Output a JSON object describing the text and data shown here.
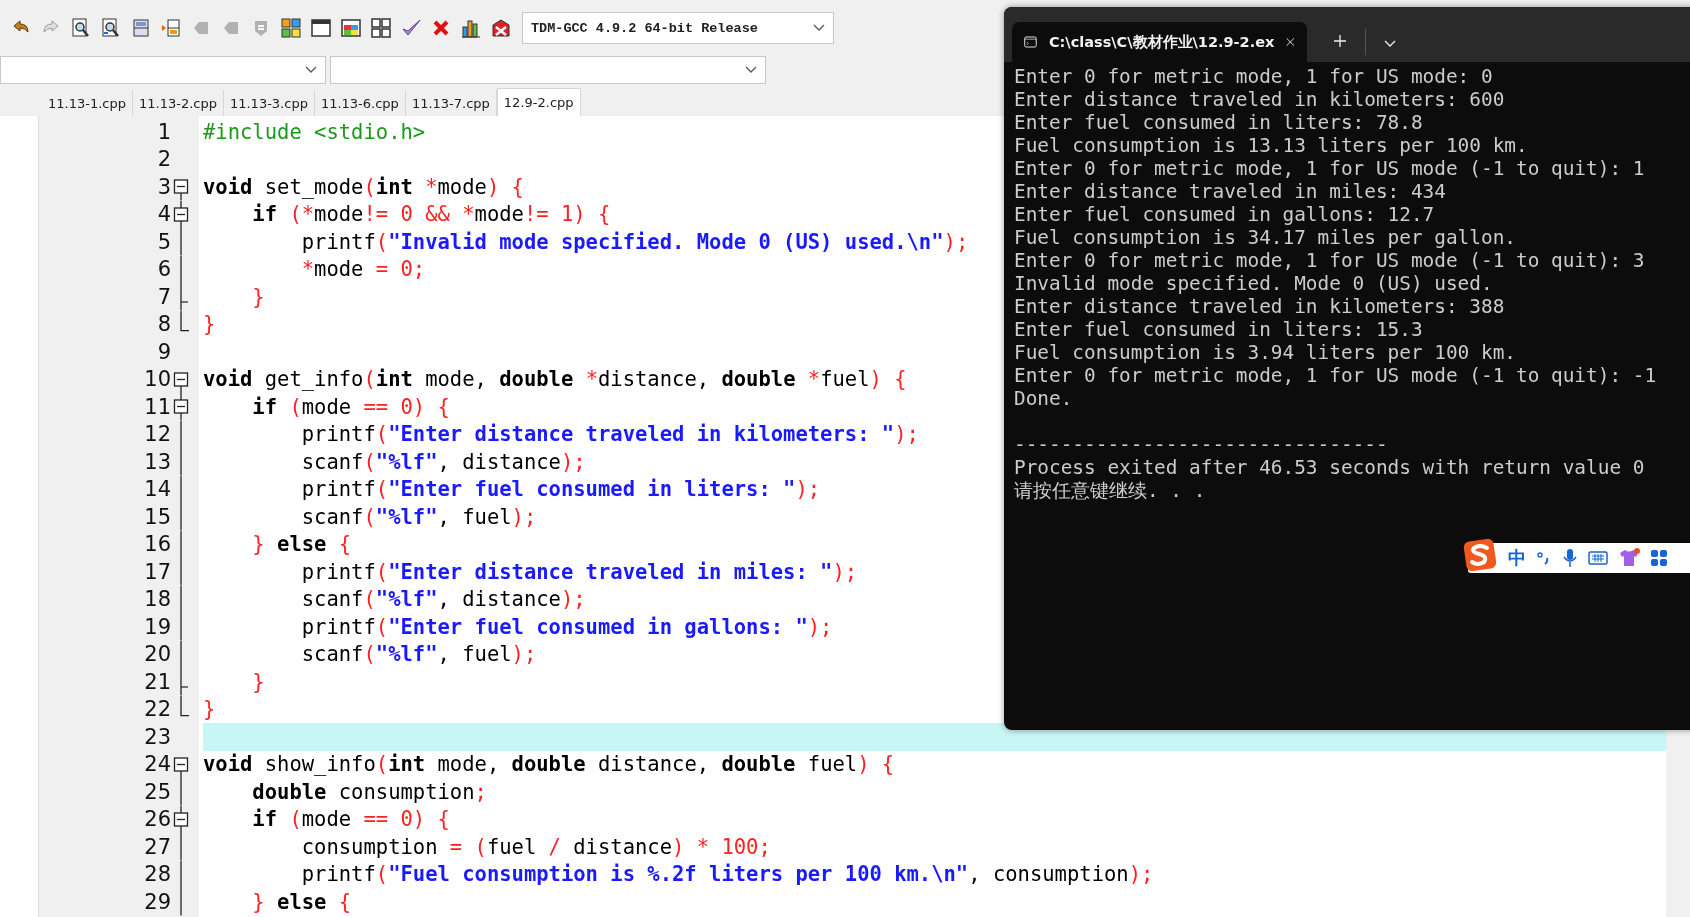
{
  "toolbar": [
    {
      "kind": "undo",
      "disabled": false
    },
    {
      "kind": "redo",
      "disabled": true
    },
    {
      "kind": "find",
      "disabled": false
    },
    {
      "kind": "replace",
      "disabled": false
    },
    {
      "kind": "indent",
      "disabled": false
    },
    {
      "kind": "unindent",
      "disabled": false
    },
    {
      "kind": "bookmark",
      "disabled": true
    },
    {
      "kind": "bookmark",
      "disabled": true
    },
    {
      "kind": "goto",
      "disabled": true
    },
    {
      "kind": "compile",
      "disabled": false
    },
    {
      "kind": "run",
      "disabled": false
    },
    {
      "kind": "compile-run",
      "disabled": false
    },
    {
      "kind": "rebuild",
      "disabled": false
    },
    {
      "kind": "check",
      "disabled": false
    },
    {
      "kind": "close",
      "disabled": false
    },
    {
      "kind": "chart",
      "disabled": false
    },
    {
      "kind": "debug",
      "disabled": false
    }
  ],
  "compiler": {
    "value": "TDM-GCC 4.9.2 64-bit Release"
  },
  "tabs": [
    {
      "label": "11.13-1.cpp",
      "selected": false
    },
    {
      "label": "11.13-2.cpp",
      "selected": false
    },
    {
      "label": "11.13-3.cpp",
      "selected": false
    },
    {
      "label": "11.13-6.cpp",
      "selected": false
    },
    {
      "label": "11.13-7.cpp",
      "selected": false
    },
    {
      "label": "12.9-2.cpp",
      "selected": true
    }
  ],
  "editor": {
    "lines": [
      {
        "number": "1",
        "current": false,
        "tokens": [
          {
            "kind": "pp",
            "text": "#include <stdio.h>"
          }
        ]
      },
      {
        "number": "2",
        "current": false
      },
      {
        "number": "3",
        "kind": "open",
        "current": false,
        "tokens": [
          {
            "kind": "kw",
            "text": "void"
          },
          {
            "kind": "id",
            "text": " set_mode"
          },
          {
            "kind": "op",
            "text": "("
          },
          {
            "kind": "kw",
            "text": "int"
          },
          {
            "kind": "op",
            "text": " *"
          },
          {
            "kind": "id",
            "text": "mode"
          },
          {
            "kind": "op",
            "text": ") {"
          }
        ]
      },
      {
        "number": "4",
        "kind": "open-inner",
        "current": false,
        "tokens": [
          {
            "kind": "kw",
            "text": "    if"
          },
          {
            "kind": "op",
            "text": " (*"
          },
          {
            "kind": "id",
            "text": "mode"
          },
          {
            "kind": "op",
            "text": "!= "
          },
          {
            "kind": "num",
            "text": "0"
          },
          {
            "kind": "op",
            "text": " && *"
          },
          {
            "kind": "id",
            "text": "mode"
          },
          {
            "kind": "op",
            "text": "!= "
          },
          {
            "kind": "num",
            "text": "1"
          },
          {
            "kind": "op",
            "text": ") {"
          }
        ]
      },
      {
        "number": "5",
        "kind": "body",
        "current": false,
        "tokens": [
          {
            "kind": "id",
            "text": "        printf"
          },
          {
            "kind": "op",
            "text": "("
          },
          {
            "kind": "str",
            "text": "\"Invalid mode specified. Mode 0 (US) used.\\n\""
          },
          {
            "kind": "op",
            "text": ");"
          }
        ]
      },
      {
        "number": "6",
        "kind": "body",
        "current": false,
        "tokens": [
          {
            "kind": "op",
            "text": "        *"
          },
          {
            "kind": "id",
            "text": "mode"
          },
          {
            "kind": "op",
            "text": " = "
          },
          {
            "kind": "num",
            "text": "0"
          },
          {
            "kind": "op",
            "text": ";"
          }
        ]
      },
      {
        "number": "7",
        "kind": "end-inner",
        "current": false,
        "tokens": [
          {
            "kind": "op",
            "text": "    }"
          }
        ]
      },
      {
        "number": "8",
        "kind": "end",
        "current": false,
        "tokens": [
          {
            "kind": "op",
            "text": "}"
          }
        ]
      },
      {
        "number": "9",
        "current": false
      },
      {
        "number": "10",
        "kind": "open",
        "current": false,
        "tokens": [
          {
            "kind": "kw",
            "text": "void"
          },
          {
            "kind": "id",
            "text": " get_info"
          },
          {
            "kind": "op",
            "text": "("
          },
          {
            "kind": "kw",
            "text": "int"
          },
          {
            "kind": "id",
            "text": " mode, "
          },
          {
            "kind": "kw",
            "text": "double"
          },
          {
            "kind": "op",
            "text": " *"
          },
          {
            "kind": "id",
            "text": "distance, "
          },
          {
            "kind": "kw",
            "text": "double"
          },
          {
            "kind": "op",
            "text": " *"
          },
          {
            "kind": "id",
            "text": "fuel"
          },
          {
            "kind": "op",
            "text": ") {"
          }
        ]
      },
      {
        "number": "11",
        "kind": "open-inner",
        "current": false,
        "tokens": [
          {
            "kind": "kw",
            "text": "    if"
          },
          {
            "kind": "op",
            "text": " ("
          },
          {
            "kind": "id",
            "text": "mode"
          },
          {
            "kind": "op",
            "text": " == "
          },
          {
            "kind": "num",
            "text": "0"
          },
          {
            "kind": "op",
            "text": ") {"
          }
        ]
      },
      {
        "number": "12",
        "kind": "body",
        "current": false,
        "tokens": [
          {
            "kind": "id",
            "text": "        printf"
          },
          {
            "kind": "op",
            "text": "("
          },
          {
            "kind": "str",
            "text": "\"Enter distance traveled in kilometers: \""
          },
          {
            "kind": "op",
            "text": ");"
          }
        ]
      },
      {
        "number": "13",
        "kind": "body",
        "current": false,
        "tokens": [
          {
            "kind": "id",
            "text": "        scanf"
          },
          {
            "kind": "op",
            "text": "("
          },
          {
            "kind": "str",
            "text": "\"%lf\""
          },
          {
            "kind": "id",
            "text": ", distance"
          },
          {
            "kind": "op",
            "text": ");"
          }
        ]
      },
      {
        "number": "14",
        "kind": "body",
        "current": false,
        "tokens": [
          {
            "kind": "id",
            "text": "        printf"
          },
          {
            "kind": "op",
            "text": "("
          },
          {
            "kind": "str",
            "text": "\"Enter fuel consumed in liters: \""
          },
          {
            "kind": "op",
            "text": ");"
          }
        ]
      },
      {
        "number": "15",
        "kind": "body",
        "current": false,
        "tokens": [
          {
            "kind": "id",
            "text": "        scanf"
          },
          {
            "kind": "op",
            "text": "("
          },
          {
            "kind": "str",
            "text": "\"%lf\""
          },
          {
            "kind": "id",
            "text": ", fuel"
          },
          {
            "kind": "op",
            "text": ");"
          }
        ]
      },
      {
        "number": "16",
        "kind": "body",
        "current": false,
        "tokens": [
          {
            "kind": "op",
            "text": "    }"
          },
          {
            "kind": "kw",
            "text": " else"
          },
          {
            "kind": "op",
            "text": " {"
          }
        ]
      },
      {
        "number": "17",
        "kind": "body",
        "current": false,
        "tokens": [
          {
            "kind": "id",
            "text": "        printf"
          },
          {
            "kind": "op",
            "text": "("
          },
          {
            "kind": "str",
            "text": "\"Enter distance traveled in miles: \""
          },
          {
            "kind": "op",
            "text": ");"
          }
        ]
      },
      {
        "number": "18",
        "kind": "body",
        "current": false,
        "tokens": [
          {
            "kind": "id",
            "text": "        scanf"
          },
          {
            "kind": "op",
            "text": "("
          },
          {
            "kind": "str",
            "text": "\"%lf\""
          },
          {
            "kind": "id",
            "text": ", distance"
          },
          {
            "kind": "op",
            "text": ");"
          }
        ]
      },
      {
        "number": "19",
        "kind": "body",
        "current": false,
        "tokens": [
          {
            "kind": "id",
            "text": "        printf"
          },
          {
            "kind": "op",
            "text": "("
          },
          {
            "kind": "str",
            "text": "\"Enter fuel consumed in gallons: \""
          },
          {
            "kind": "op",
            "text": ");"
          }
        ]
      },
      {
        "number": "20",
        "kind": "body",
        "current": false,
        "tokens": [
          {
            "kind": "id",
            "text": "        scanf"
          },
          {
            "kind": "op",
            "text": "("
          },
          {
            "kind": "str",
            "text": "\"%lf\""
          },
          {
            "kind": "id",
            "text": ", fuel"
          },
          {
            "kind": "op",
            "text": ");"
          }
        ]
      },
      {
        "number": "21",
        "kind": "end-inner",
        "current": false,
        "tokens": [
          {
            "kind": "op",
            "text": "    }"
          }
        ]
      },
      {
        "number": "22",
        "kind": "end",
        "current": false,
        "tokens": [
          {
            "kind": "op",
            "text": "}"
          }
        ]
      },
      {
        "number": "23",
        "current": true
      },
      {
        "number": "24",
        "kind": "open",
        "current": false,
        "tokens": [
          {
            "kind": "kw",
            "text": "void"
          },
          {
            "kind": "id",
            "text": " show_info"
          },
          {
            "kind": "op",
            "text": "("
          },
          {
            "kind": "kw",
            "text": "int"
          },
          {
            "kind": "id",
            "text": " mode, "
          },
          {
            "kind": "kw",
            "text": "double"
          },
          {
            "kind": "id",
            "text": " distance, "
          },
          {
            "kind": "kw",
            "text": "double"
          },
          {
            "kind": "id",
            "text": " fuel"
          },
          {
            "kind": "op",
            "text": ") {"
          }
        ]
      },
      {
        "number": "25",
        "kind": "body",
        "current": false,
        "tokens": [
          {
            "kind": "kw",
            "text": "    double"
          },
          {
            "kind": "id",
            "text": " consumption"
          },
          {
            "kind": "op",
            "text": ";"
          }
        ]
      },
      {
        "number": "26",
        "kind": "open-inner",
        "current": false,
        "tokens": [
          {
            "kind": "kw",
            "text": "    if"
          },
          {
            "kind": "op",
            "text": " ("
          },
          {
            "kind": "id",
            "text": "mode"
          },
          {
            "kind": "op",
            "text": " == "
          },
          {
            "kind": "num",
            "text": "0"
          },
          {
            "kind": "op",
            "text": ") {"
          }
        ]
      },
      {
        "number": "27",
        "kind": "body",
        "current": false,
        "tokens": [
          {
            "kind": "id",
            "text": "        consumption"
          },
          {
            "kind": "op",
            "text": " = ("
          },
          {
            "kind": "id",
            "text": "fuel"
          },
          {
            "kind": "op",
            "text": " / "
          },
          {
            "kind": "id",
            "text": "distance"
          },
          {
            "kind": "op",
            "text": ") * "
          },
          {
            "kind": "num",
            "text": "100"
          },
          {
            "kind": "op",
            "text": ";"
          }
        ]
      },
      {
        "number": "28",
        "kind": "body",
        "current": false,
        "tokens": [
          {
            "kind": "id",
            "text": "        printf"
          },
          {
            "kind": "op",
            "text": "("
          },
          {
            "kind": "str",
            "text": "\"Fuel consumption is %.2f liters per 100 km.\\n\""
          },
          {
            "kind": "id",
            "text": ", consumption"
          },
          {
            "kind": "op",
            "text": ");"
          }
        ]
      },
      {
        "number": "29",
        "kind": "body",
        "current": false,
        "tokens": [
          {
            "kind": "op",
            "text": "    }"
          },
          {
            "kind": "kw",
            "text": " else"
          },
          {
            "kind": "op",
            "text": " {"
          }
        ]
      }
    ]
  },
  "terminal": {
    "tab_title": "C:\\class\\C\\教材作业\\12.9-2.ex",
    "output": [
      "Enter 0 for metric mode, 1 for US mode: 0",
      "Enter distance traveled in kilometers: 600",
      "Enter fuel consumed in liters: 78.8",
      "Fuel consumption is 13.13 liters per 100 km.",
      "Enter 0 for metric mode, 1 for US mode (-1 to quit): 1",
      "Enter distance traveled in miles: 434",
      "Enter fuel consumed in gallons: 12.7",
      "Fuel consumption is 34.17 miles per gallon.",
      "Enter 0 for metric mode, 1 for US mode (-1 to quit): 3",
      "Invalid mode specified. Mode 0 (US) used.",
      "Enter distance traveled in kilometers: 388",
      "Enter fuel consumed in liters: 15.3",
      "Fuel consumption is 3.94 liters per 100 km.",
      "Enter 0 for metric mode, 1 for US mode (-1 to quit): -1",
      "Done."
    ],
    "summary": [
      "--------------------------------",
      "Process exited after 46.53 seconds with return value 0",
      "请按任意键继续. . ."
    ]
  },
  "ime": {
    "mode": "中"
  }
}
